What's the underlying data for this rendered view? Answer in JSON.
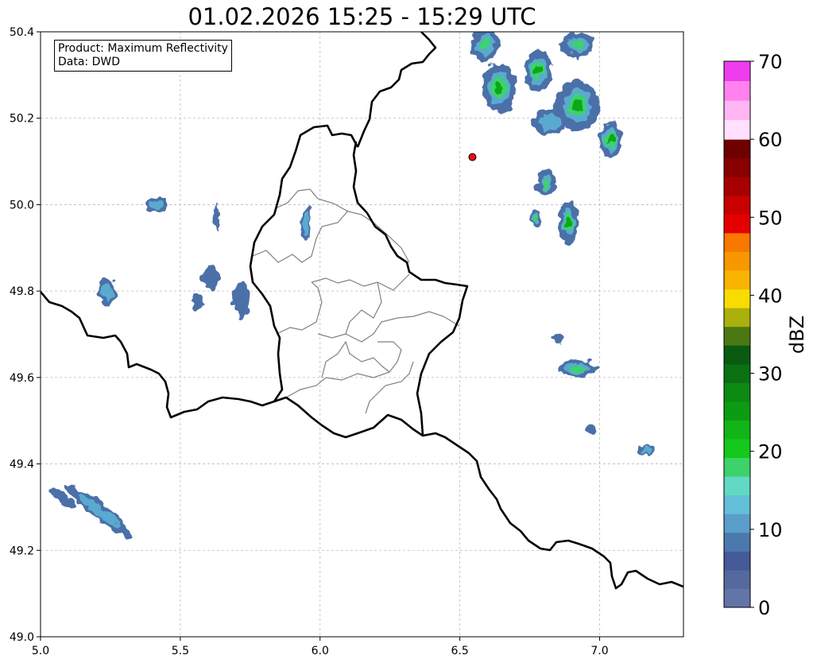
{
  "title": "01.02.2026 15:25 - 15:29 UTC",
  "info": {
    "product": "Product: Maximum Reflectivity",
    "source": "Data: DWD"
  },
  "axes": {
    "lon_range": [
      5.0,
      7.3
    ],
    "lat_range": [
      49.0,
      50.4
    ],
    "x_ticks": [
      "5.0",
      "5.5",
      "6.0",
      "6.5",
      "7.0"
    ],
    "x_tick_values": [
      5.0,
      5.5,
      6.0,
      6.5,
      7.0
    ],
    "y_ticks": [
      "49.0",
      "49.2",
      "49.4",
      "49.6",
      "49.8",
      "50.0",
      "50.2",
      "50.4"
    ],
    "y_tick_values": [
      49.0,
      49.2,
      49.4,
      49.6,
      49.8,
      50.0,
      50.2,
      50.4
    ],
    "grid": true
  },
  "colorbar": {
    "label": "dBZ",
    "range": [
      0,
      70
    ],
    "tick_labels": [
      "0",
      "10",
      "20",
      "30",
      "40",
      "50",
      "60",
      "70"
    ],
    "tick_values": [
      0,
      10,
      20,
      30,
      40,
      50,
      60,
      70
    ],
    "colors": [
      "#6374a8",
      "#56699f",
      "#455a99",
      "#4b79ae",
      "#5a9ec9",
      "#63bfd8",
      "#62d8c5",
      "#3cd36c",
      "#14c81c",
      "#11b518",
      "#0c9c14",
      "#0c8a12",
      "#0a7012",
      "#0a5a10",
      "#4a7812",
      "#aab00c",
      "#f8dc00",
      "#f8b400",
      "#f89800",
      "#f87800",
      "#e40000",
      "#c80000",
      "#a60000",
      "#880000",
      "#6e0000",
      "#ffe0ff",
      "#ffb4f4",
      "#ff82ee",
      "#ee3cee"
    ]
  },
  "marker": {
    "lon": 6.545,
    "lat": 50.11,
    "color": "#e81010"
  },
  "colors": {
    "border": "#000000",
    "district": "#808080",
    "grid": "#bbbbbb"
  },
  "echoes": [
    {
      "lon": 6.64,
      "lat": 50.27,
      "rlon": 0.06,
      "rlat": 0.06,
      "level": 3
    },
    {
      "lon": 6.78,
      "lat": 50.31,
      "rlon": 0.05,
      "rlat": 0.05,
      "level": 3
    },
    {
      "lon": 6.92,
      "lat": 50.23,
      "rlon": 0.08,
      "rlat": 0.06,
      "level": 3
    },
    {
      "lon": 7.04,
      "lat": 50.15,
      "rlon": 0.04,
      "rlat": 0.04,
      "level": 3
    },
    {
      "lon": 6.59,
      "lat": 50.37,
      "rlon": 0.05,
      "rlat": 0.04,
      "level": 2
    },
    {
      "lon": 6.92,
      "lat": 50.37,
      "rlon": 0.06,
      "rlat": 0.03,
      "level": 2
    },
    {
      "lon": 6.82,
      "lat": 50.19,
      "rlon": 0.06,
      "rlat": 0.03,
      "level": 1
    },
    {
      "lon": 6.89,
      "lat": 49.96,
      "rlon": 0.035,
      "rlat": 0.05,
      "level": 3
    },
    {
      "lon": 6.81,
      "lat": 50.05,
      "rlon": 0.035,
      "rlat": 0.03,
      "level": 2
    },
    {
      "lon": 6.77,
      "lat": 49.97,
      "rlon": 0.02,
      "rlat": 0.02,
      "level": 2
    },
    {
      "lon": 6.92,
      "lat": 49.62,
      "rlon": 0.07,
      "rlat": 0.02,
      "level": 2
    },
    {
      "lon": 7.17,
      "lat": 49.43,
      "rlon": 0.03,
      "rlat": 0.01,
      "level": 1
    },
    {
      "lon": 6.97,
      "lat": 49.48,
      "rlon": 0.02,
      "rlat": 0.01,
      "level": 0
    },
    {
      "lon": 6.85,
      "lat": 49.69,
      "rlon": 0.02,
      "rlat": 0.01,
      "level": 0
    },
    {
      "lon": 5.41,
      "lat": 50.0,
      "rlon": 0.04,
      "rlat": 0.02,
      "level": 1
    },
    {
      "lon": 5.63,
      "lat": 49.97,
      "rlon": 0.01,
      "rlat": 0.03,
      "level": 0
    },
    {
      "lon": 5.24,
      "lat": 49.8,
      "rlon": 0.03,
      "rlat": 0.03,
      "level": 1
    },
    {
      "lon": 5.61,
      "lat": 49.83,
      "rlon": 0.03,
      "rlat": 0.03,
      "level": 0
    },
    {
      "lon": 5.72,
      "lat": 49.78,
      "rlon": 0.03,
      "rlat": 0.04,
      "level": 0
    },
    {
      "lon": 5.56,
      "lat": 49.77,
      "rlon": 0.02,
      "rlat": 0.02,
      "level": 0
    },
    {
      "lon": 5.95,
      "lat": 49.96,
      "rlon": 0.02,
      "rlat": 0.04,
      "level": 1
    },
    {
      "lon": 5.21,
      "lat": 49.29,
      "rlon": 0.15,
      "rlat": 0.018,
      "level": 1
    },
    {
      "lon": 5.08,
      "lat": 49.32,
      "rlon": 0.05,
      "rlat": 0.012,
      "level": 0
    }
  ]
}
